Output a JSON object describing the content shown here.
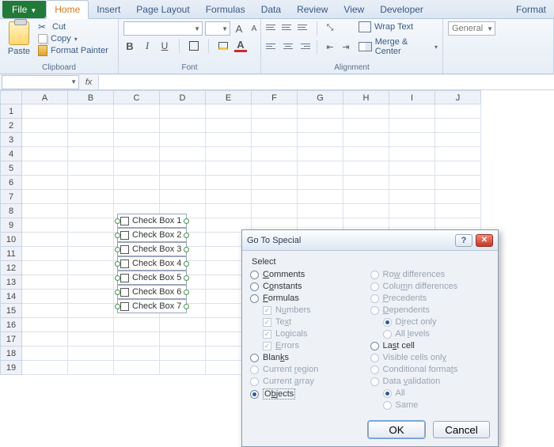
{
  "ribbon": {
    "file": "File",
    "tabs": [
      "Home",
      "Insert",
      "Page Layout",
      "Formulas",
      "Data",
      "Review",
      "View",
      "Developer",
      "Format"
    ],
    "active_tab": "Home",
    "clipboard": {
      "label": "Clipboard",
      "paste": "Paste",
      "cut": "Cut",
      "copy": "Copy",
      "format_painter": "Format Painter"
    },
    "font": {
      "label": "Font",
      "family": "",
      "size": "",
      "bold": "B",
      "italic": "I",
      "underline": "U",
      "grow": "A",
      "shrink": "A"
    },
    "alignment": {
      "label": "Alignment",
      "wrap": "Wrap Text",
      "merge": "Merge & Center"
    },
    "number": {
      "label": "",
      "format": "General"
    }
  },
  "formula_bar": {
    "name_box": "",
    "fx": "fx"
  },
  "grid": {
    "columns": [
      "A",
      "B",
      "C",
      "D",
      "E",
      "F",
      "G",
      "H",
      "I",
      "J"
    ],
    "row_count": 19
  },
  "checkboxes": [
    "Check Box 1",
    "Check Box 2",
    "Check Box 3",
    "Check Box 4",
    "Check Box 5",
    "Check Box 6",
    "Check Box 7"
  ],
  "dialog": {
    "title": "Go To Special",
    "section": "Select",
    "left": {
      "comments": "Comments",
      "constants": "Constants",
      "formulas": "Formulas",
      "numbers": "Numbers",
      "text": "Text",
      "logicals": "Logicals",
      "errors": "Errors",
      "blanks": "Blanks",
      "current_region": "Current region",
      "current_array": "Current array",
      "objects": "Objects"
    },
    "right": {
      "row_diff": "Row differences",
      "col_diff": "Column differences",
      "precedents": "Precedents",
      "dependents": "Dependents",
      "direct_only": "Direct only",
      "all_levels": "All levels",
      "last_cell": "Last cell",
      "visible": "Visible cells only",
      "cond_formats": "Conditional formats",
      "data_validation": "Data validation",
      "all": "All",
      "same": "Same"
    },
    "selected": "objects",
    "ok": "OK",
    "cancel": "Cancel"
  }
}
